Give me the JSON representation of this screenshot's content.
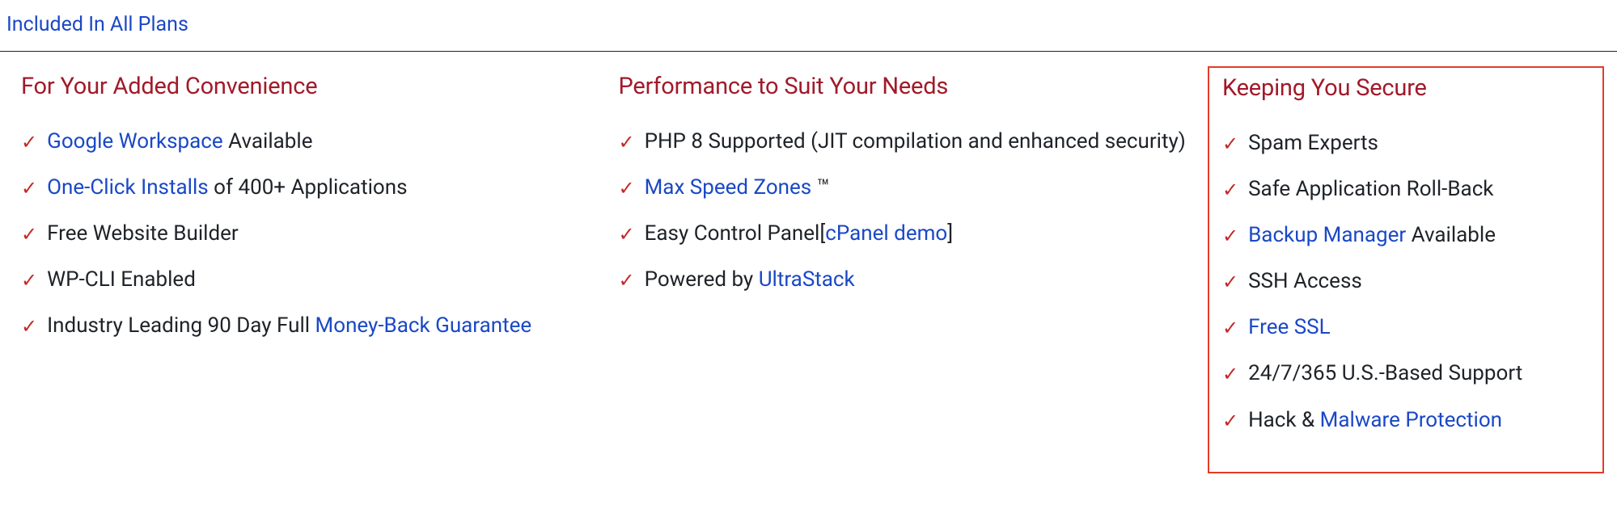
{
  "pageTitle": "Included In All Plans",
  "columns": [
    {
      "title": "For Your Added Convenience",
      "highlighted": false,
      "items": [
        {
          "parts": [
            {
              "t": "link",
              "v": "Google Workspace"
            },
            {
              "t": "text",
              "v": " Available"
            }
          ]
        },
        {
          "parts": [
            {
              "t": "link",
              "v": "One-Click Installs"
            },
            {
              "t": "text",
              "v": " of 400+ Applications"
            }
          ]
        },
        {
          "parts": [
            {
              "t": "text",
              "v": "Free Website Builder"
            }
          ]
        },
        {
          "parts": [
            {
              "t": "text",
              "v": "WP-CLI Enabled"
            }
          ]
        },
        {
          "parts": [
            {
              "t": "text",
              "v": "Industry Leading 90 Day Full "
            },
            {
              "t": "link",
              "v": "Money-Back Guarantee"
            }
          ]
        }
      ]
    },
    {
      "title": "Performance to Suit Your Needs",
      "highlighted": false,
      "items": [
        {
          "parts": [
            {
              "t": "text",
              "v": "PHP 8 Supported (JIT compilation and enhanced security)"
            }
          ]
        },
        {
          "parts": [
            {
              "t": "link",
              "v": "Max Speed Zones"
            },
            {
              "t": "text",
              "v": " ™"
            }
          ]
        },
        {
          "parts": [
            {
              "t": "text",
              "v": "Easy Control Panel["
            },
            {
              "t": "link",
              "v": "cPanel demo"
            },
            {
              "t": "text",
              "v": "]"
            }
          ]
        },
        {
          "parts": [
            {
              "t": "text",
              "v": "Powered by "
            },
            {
              "t": "link",
              "v": "UltraStack"
            }
          ]
        }
      ]
    },
    {
      "title": "Keeping You Secure",
      "highlighted": true,
      "items": [
        {
          "parts": [
            {
              "t": "text",
              "v": "Spam Experts"
            }
          ]
        },
        {
          "parts": [
            {
              "t": "text",
              "v": "Safe Application Roll-Back"
            }
          ]
        },
        {
          "parts": [
            {
              "t": "link",
              "v": "Backup Manager"
            },
            {
              "t": "text",
              "v": " Available"
            }
          ]
        },
        {
          "parts": [
            {
              "t": "text",
              "v": "SSH Access"
            }
          ]
        },
        {
          "parts": [
            {
              "t": "link",
              "v": "Free SSL"
            }
          ]
        },
        {
          "parts": [
            {
              "t": "text",
              "v": "24/7/365 U.S.-Based Support"
            }
          ]
        },
        {
          "parts": [
            {
              "t": "text",
              "v": "Hack & "
            },
            {
              "t": "link",
              "v": "Malware Protection"
            }
          ]
        }
      ]
    }
  ]
}
